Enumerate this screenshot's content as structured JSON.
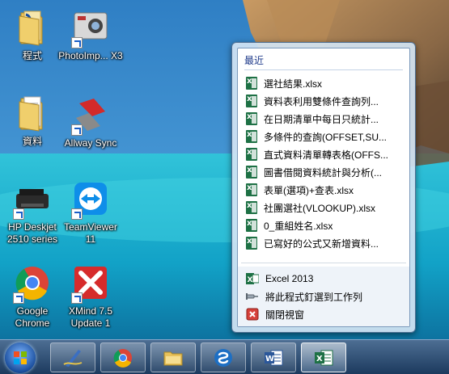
{
  "desktop": {
    "icons": [
      {
        "label": "程式",
        "icon": "folder-icon"
      },
      {
        "label": "PhotoImp... X3",
        "icon": "photoimpact-icon"
      },
      {
        "label": "資料",
        "icon": "folder-icon"
      },
      {
        "label": "Allway Sync",
        "icon": "allway-sync-icon"
      },
      {
        "label": "HP Deskjet 2510 series",
        "icon": "printer-icon"
      },
      {
        "label": "TeamViewer 11",
        "icon": "teamviewer-icon"
      },
      {
        "label": "Google Chrome",
        "icon": "chrome-icon"
      },
      {
        "label": "XMind 7.5 Update 1",
        "icon": "xmind-icon"
      }
    ]
  },
  "jumplist": {
    "heading": "最近",
    "recent": [
      "選社結果.xlsx",
      "資料表利用雙條件查詢列...",
      "在日期清單中每日只統計...",
      "多條件的查詢(OFFSET,SU...",
      "直式資料清單轉表格(OFFS...",
      "圖書借閱資料統計與分析(...",
      "表單(選項)+查表.xlsx",
      "社團選社(VLOOKUP).xlsx",
      "0_重組姓名.xlsx",
      "已寫好的公式又新增資料..."
    ],
    "tasks": {
      "app": "Excel 2013",
      "pin": "將此程式釘選到工作列",
      "close": "關閉視窗"
    }
  },
  "taskbar": {
    "buttons": [
      "start-button",
      "pen-app-icon",
      "chrome-icon",
      "file-explorer-icon",
      "ssh-app-icon",
      "word-icon",
      "excel-icon"
    ]
  },
  "colors": {
    "excel_green": "#1e7145",
    "heading_blue": "#1e3a8a",
    "taskbar_top": "#4d6e93",
    "taskbar_bottom": "#1c3a5e"
  }
}
